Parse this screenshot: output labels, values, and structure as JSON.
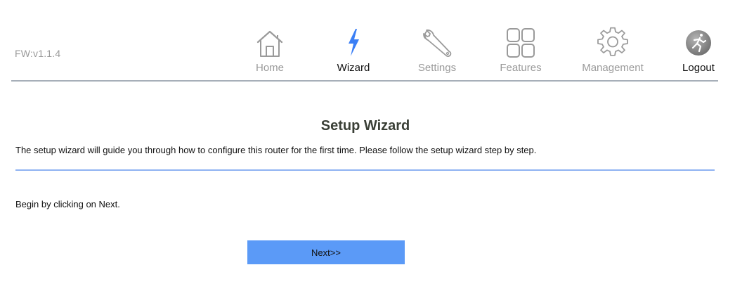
{
  "header": {
    "firmware_version": "FW:v1.1.4"
  },
  "nav": {
    "items": [
      {
        "label": "Home",
        "icon": "home-icon",
        "active": false
      },
      {
        "label": "Wizard",
        "icon": "wizard-bolt-icon",
        "active": true
      },
      {
        "label": "Settings",
        "icon": "wrench-icon",
        "active": false
      },
      {
        "label": "Features",
        "icon": "grid-icon",
        "active": false
      },
      {
        "label": "Management",
        "icon": "gear-icon",
        "active": false
      },
      {
        "label": "Logout",
        "icon": "logout-icon",
        "active": false
      }
    ]
  },
  "wizard": {
    "title": "Setup Wizard",
    "description": "The setup wizard will guide you through how to configure this router for the first time. Please follow the setup wizard step by step.",
    "instruction": "Begin by clicking on Next.",
    "next_label": "Next>>"
  },
  "colors": {
    "accent": "#5b9af7",
    "active_icon": "#3b7ff5",
    "inactive_text": "#9a9a9a",
    "divider": "#8fb3f2"
  }
}
